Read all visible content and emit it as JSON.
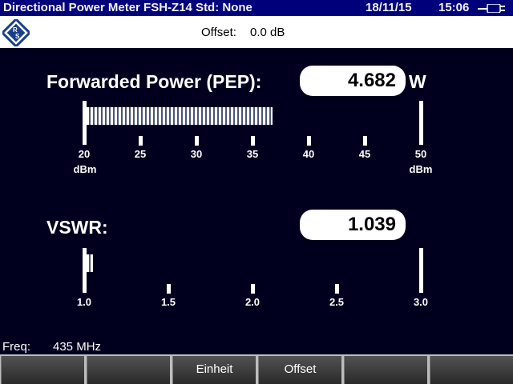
{
  "titlebar": {
    "title": "Directional Power Meter FSH-Z14 Std: None",
    "date": "18/11/15",
    "time": "15:06",
    "battery_icon": "plug-icon"
  },
  "header": {
    "logo_icon": "rohde-schwarz-logo-icon",
    "offset_label": "Offset:",
    "offset_value": "0.0 dB"
  },
  "forward": {
    "label": "Forwarded Power (PEP):",
    "value": "4.682",
    "unit": "W",
    "scale": [
      "20",
      "25",
      "30",
      "35",
      "40",
      "45",
      "50"
    ],
    "scale_unit": "dBm",
    "bar_level_dbm": 36.7
  },
  "vswr": {
    "label": "VSWR:",
    "value": "1.039",
    "scale": [
      "1.0",
      "1.5",
      "2.0",
      "2.5",
      "3.0"
    ],
    "bar_level": 1.039
  },
  "status": {
    "freq_label": "Freq:",
    "freq_value": "435 MHz"
  },
  "softkeys": [
    "",
    "",
    "Einheit",
    "Offset",
    "",
    ""
  ],
  "colors": {
    "background": "#00001e",
    "titlebar": "#00007a",
    "softkey": "#3a3a3a"
  }
}
